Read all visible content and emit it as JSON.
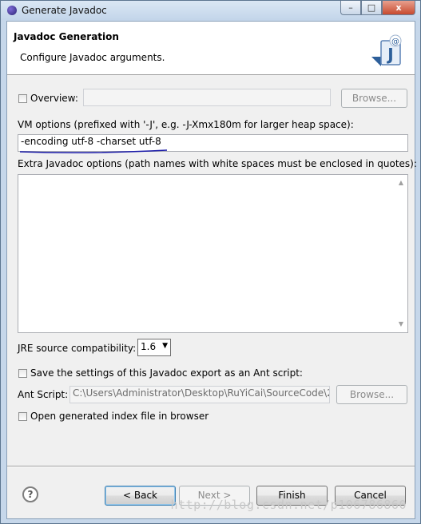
{
  "window": {
    "title": "Generate Javadoc",
    "minimize_glyph": "–",
    "maximize_glyph": "□",
    "close_glyph": "x"
  },
  "banner": {
    "title": "Javadoc Generation",
    "description": "Configure Javadoc arguments."
  },
  "overview": {
    "label": "Overview:",
    "checked": false,
    "value": "",
    "browse_label": "Browse..."
  },
  "vm_options": {
    "label": "VM options (prefixed with '-J', e.g. -J-Xmx180m for larger heap space):",
    "value": "-encoding utf-8 -charset utf-8"
  },
  "extra_options": {
    "label": "Extra Javadoc options (path names with white spaces must be enclosed in quotes):",
    "value": ""
  },
  "jre": {
    "label": "JRE source compatibility:",
    "selected": "1.6"
  },
  "ant": {
    "save_label": "Save the settings of this Javadoc export as an Ant script:",
    "save_checked": false,
    "script_label": "Ant Script:",
    "script_value": "C:\\Users\\Administrator\\Desktop\\RuYiCai\\SourceCode\\2",
    "browse_label": "Browse..."
  },
  "open_index": {
    "label": "Open generated index file in browser",
    "checked": false
  },
  "buttons": {
    "help": "?",
    "back": "< Back",
    "next": "Next >",
    "finish": "Finish",
    "cancel": "Cancel"
  },
  "watermark": "http://blog.csdn.net/p106786860",
  "colors": {
    "annotation_underline": "#1a1aa8"
  }
}
